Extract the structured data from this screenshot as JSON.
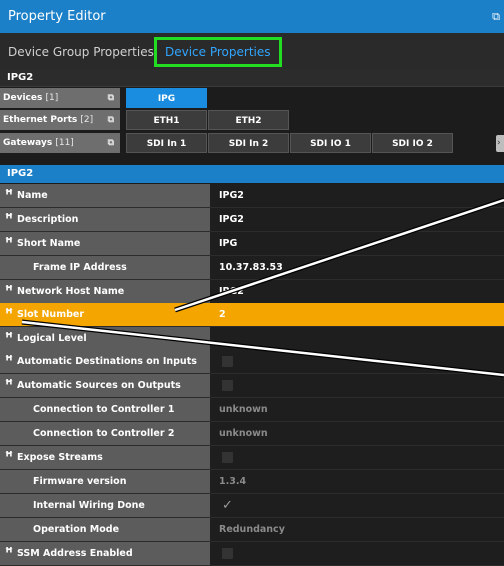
{
  "title": "Property Editor",
  "tabs": [
    {
      "label": "Device Group Properties"
    },
    {
      "label": "Device Properties"
    }
  ],
  "group": {
    "name": "IPG2",
    "rows": [
      {
        "label": "Devices",
        "count": "[1]",
        "cells": [
          "IPG"
        ]
      },
      {
        "label": "Ethernet Ports",
        "count": "[2]",
        "cells": [
          "ETH1",
          "ETH2"
        ]
      },
      {
        "label": "Gateways",
        "count": "[11]",
        "cells": [
          "SDI In 1",
          "SDI In 2",
          "SDI IO 1",
          "SDI IO 2"
        ]
      }
    ]
  },
  "properties": {
    "section": "IPG2",
    "rows": [
      {
        "label": "Name",
        "value": "IPG2"
      },
      {
        "label": "Description",
        "value": "IPG2"
      },
      {
        "label": "Short Name",
        "value": "IPG"
      },
      {
        "label": "Frame IP Address",
        "value": "10.37.83.53"
      },
      {
        "label": "Network Host Name",
        "value": "IPG2"
      },
      {
        "label": "Slot Number",
        "value": "2"
      },
      {
        "label": "Logical Level",
        "value": ""
      },
      {
        "label": "Automatic Destinations on Inputs",
        "value": ""
      },
      {
        "label": "Automatic Sources on Outputs",
        "value": ""
      },
      {
        "label": "Connection to Controller 1",
        "value": "unknown"
      },
      {
        "label": "Connection to Controller 2",
        "value": "unknown"
      },
      {
        "label": "Expose Streams",
        "value": ""
      },
      {
        "label": "Firmware version",
        "value": "1.3.4"
      },
      {
        "label": "Internal Wiring Done",
        "value": ""
      },
      {
        "label": "Operation Mode",
        "value": "Redundancy"
      },
      {
        "label": "SSM Address Enabled",
        "value": ""
      }
    ]
  },
  "icons": {
    "link": "link-icon",
    "popout": "popout-icon"
  },
  "colors": {
    "titlebar": "#1c80c8",
    "highlight": "#f5a500",
    "tab_outline": "#22dd22",
    "selected_cell": "#1a8de0"
  }
}
